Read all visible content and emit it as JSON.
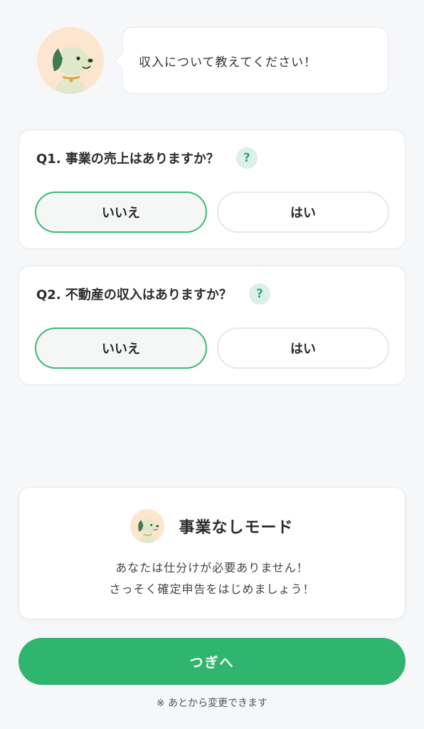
{
  "header": {
    "message": "収入について教えてください！"
  },
  "questions": [
    {
      "title": "Q1. 事業の売上はありますか？",
      "help": "?",
      "options": {
        "no": "いいえ",
        "yes": "はい"
      },
      "selected": "no"
    },
    {
      "title": "Q2. 不動産の収入はありますか？",
      "help": "?",
      "options": {
        "no": "いいえ",
        "yes": "はい"
      },
      "selected": "no"
    }
  ],
  "mode": {
    "title": "事業なしモード",
    "line1": "あなたは仕分けが必要ありません！",
    "line2": "さっそく確定申告をはじめましょう！"
  },
  "actions": {
    "next_label": "つぎへ",
    "note": "※ あとから変更できます"
  },
  "colors": {
    "accent": "#2fb56e",
    "selected_border": "#3cb878",
    "avatar_bg": "#fde6cf",
    "help_bg": "#dcefeb"
  },
  "icons": {
    "mascot": "dog-mascot-icon",
    "help": "question-mark-icon"
  }
}
